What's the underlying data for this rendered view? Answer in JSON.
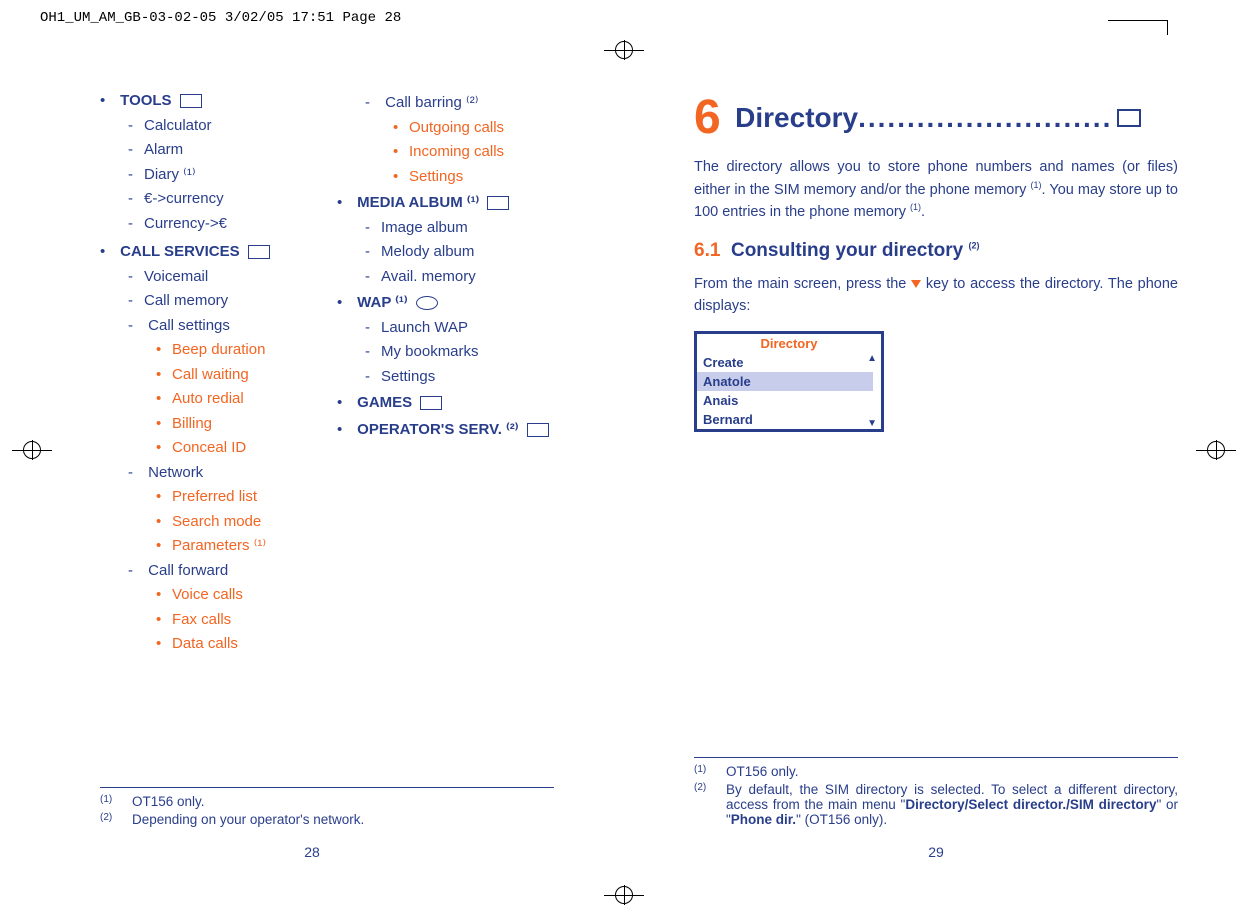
{
  "print_header": "OH1_UM_AM_GB-03-02-05   3/02/05  17:51  Page 28",
  "left": {
    "col1": {
      "tools": {
        "title": "TOOLS",
        "items": [
          "Calculator",
          "Alarm",
          "Diary ⁽¹⁾",
          "€->currency",
          "Currency->€"
        ]
      },
      "call_services": {
        "title": "CALL SERVICES",
        "items": [
          {
            "label": "Voicemail"
          },
          {
            "label": "Call memory"
          },
          {
            "label": "Call settings",
            "sub": [
              "Beep duration",
              "Call waiting",
              "Auto redial",
              "Billing",
              "Conceal ID"
            ]
          },
          {
            "label": "Network",
            "sub": [
              "Preferred list",
              "Search mode",
              "Parameters ⁽¹⁾"
            ]
          },
          {
            "label": "Call forward",
            "sub": [
              "Voice calls",
              "Fax calls",
              "Data calls"
            ]
          }
        ]
      }
    },
    "col2": {
      "call_barring": {
        "label": "Call barring ⁽²⁾",
        "sub": [
          "Outgoing calls",
          "Incoming calls",
          "Settings"
        ]
      },
      "media_album": {
        "title": "MEDIA ALBUM ⁽¹⁾",
        "items": [
          "Image album",
          "Melody album",
          "Avail. memory"
        ]
      },
      "wap": {
        "title": "WAP ⁽¹⁾",
        "items": [
          "Launch WAP",
          "My bookmarks",
          "Settings"
        ]
      },
      "games": {
        "title": "GAMES"
      },
      "operator": {
        "title": "OPERATOR'S SERV. ⁽²⁾"
      }
    },
    "footnotes": [
      {
        "mark": "(1)",
        "text": "OT156 only."
      },
      {
        "mark": "(2)",
        "text": "Depending on your operator's network."
      }
    ],
    "pagenum": "28"
  },
  "right": {
    "chapter_num": "6",
    "chapter_title": "Directory",
    "intro1": "The directory allows you to store phone numbers and names (or files) either in the SIM memory and/or the phone memory ",
    "intro_sup1": "(1)",
    "intro2": ".  You may store up to 100 entries in the phone memory ",
    "intro_sup2": "(1)",
    "intro3": ".",
    "section_num": "6.1",
    "section_title": "Consulting your directory ",
    "section_sup": "(2)",
    "body1": "From the main screen, press the ",
    "body2": " key to access the directory. The phone displays:",
    "screen": {
      "title": "Directory",
      "rows": [
        "Create",
        "Anatole",
        "Anais",
        "Bernard"
      ],
      "selected": 1
    },
    "footnotes": [
      {
        "mark": "(1)",
        "text": "OT156 only."
      },
      {
        "mark": "(2)",
        "text_a": "By default, the SIM directory is selected. To select a different directory, access from the main menu \"",
        "bold1": "Directory/Select director./SIM directory",
        "text_b": "\" or \"",
        "bold2": "Phone dir.",
        "text_c": "\" (OT156 only)."
      }
    ],
    "pagenum": "29"
  }
}
